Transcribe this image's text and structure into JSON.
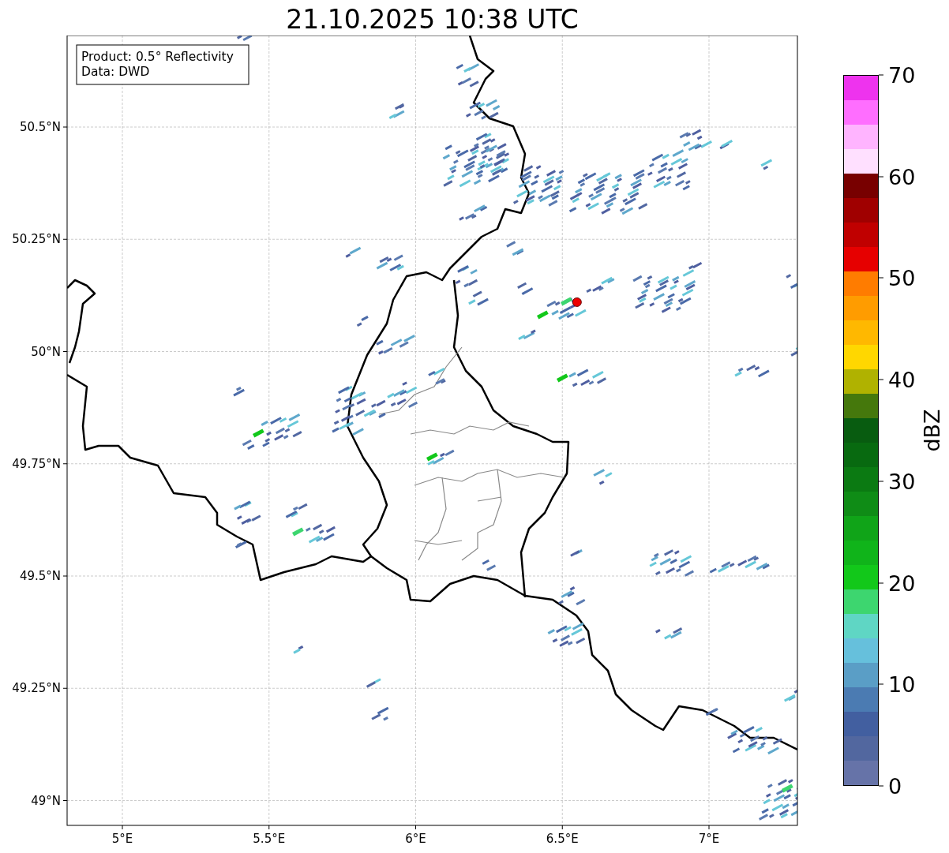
{
  "title": "21.10.2025 10:38 UTC",
  "map": {
    "info_box": [
      "Product: 0.5° Reflectivity",
      "Data: DWD"
    ],
    "xticks": [
      "5°E",
      "5.5°E",
      "6°E",
      "6.5°E",
      "7°E"
    ],
    "yticks": [
      "50.5°N",
      "50.25°N",
      "50°N",
      "49.75°N",
      "49.5°N",
      "49.25°N",
      "49°N"
    ]
  },
  "colorbar": {
    "label": "dBZ",
    "ticks": [
      "70",
      "60",
      "50",
      "40",
      "30",
      "20",
      "10",
      "0"
    ],
    "bands": [
      {
        "color": "#6673a8"
      },
      {
        "color": "#52679f"
      },
      {
        "color": "#425fa0"
      },
      {
        "color": "#4b7bb2"
      },
      {
        "color": "#5a9ec6"
      },
      {
        "color": "#66c0dc"
      },
      {
        "color": "#5fd6c4"
      },
      {
        "color": "#3dd66f"
      },
      {
        "color": "#12c81a"
      },
      {
        "color": "#10b41a"
      },
      {
        "color": "#10a418"
      },
      {
        "color": "#0f8c16"
      },
      {
        "color": "#0b7a12"
      },
      {
        "color": "#086a10"
      },
      {
        "color": "#085c10"
      },
      {
        "color": "#45780c"
      },
      {
        "color": "#b0b200"
      },
      {
        "color": "#ffd700"
      },
      {
        "color": "#ffb800"
      },
      {
        "color": "#ff9c00"
      },
      {
        "color": "#ff7c00"
      },
      {
        "color": "#e60000"
      },
      {
        "color": "#c00000"
      },
      {
        "color": "#a00000"
      },
      {
        "color": "#780000"
      },
      {
        "color": "#ffe0ff"
      },
      {
        "color": "#ffb4ff"
      },
      {
        "color": "#ff6eff"
      },
      {
        "color": "#ee33ee"
      }
    ]
  }
}
